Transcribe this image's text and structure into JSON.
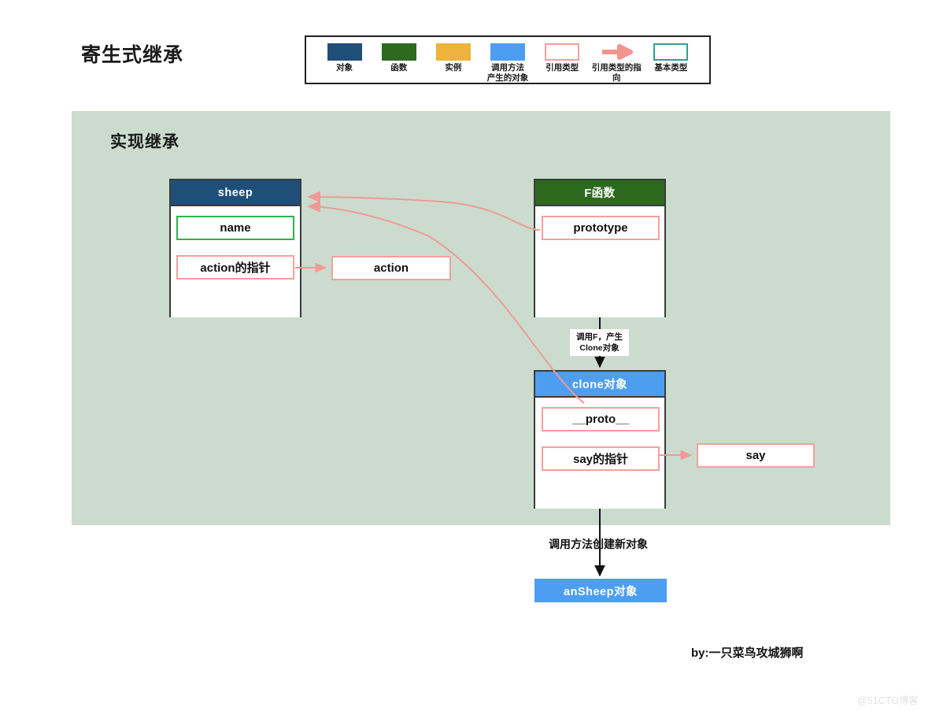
{
  "page": {
    "title": "寄生式继承",
    "credit": "by:一只菜鸟攻城狮啊",
    "watermark": "@51CTO博客",
    "background": "#ffffff"
  },
  "legend": {
    "items": [
      {
        "label": "对象",
        "swatch": "solid",
        "color": "#1f4e79",
        "icon": "filled-square-navy"
      },
      {
        "label": "函数",
        "swatch": "solid",
        "color": "#2d6a1f",
        "icon": "filled-square-green"
      },
      {
        "label": "实例",
        "swatch": "solid",
        "color": "#edb33c",
        "icon": "filled-square-yellow"
      },
      {
        "label": "调用方法\n产生的对象",
        "swatch": "solid",
        "color": "#4d9ef0",
        "icon": "filled-square-blue"
      },
      {
        "label": "引用类型",
        "swatch": "outline",
        "color": "#f4a09c",
        "icon": "outline-square-pink"
      },
      {
        "label": "引用类型的指向",
        "swatch": "arrow",
        "color": "#f4928c",
        "icon": "arrow-right-icon"
      },
      {
        "label": "基本类型",
        "swatch": "outline-teal",
        "color": "#2e9e96",
        "icon": "outline-square-teal"
      }
    ]
  },
  "panel": {
    "heading": "实现继承",
    "background": "#cbdccf"
  },
  "diagram": {
    "sheep": {
      "header": "sheep",
      "header_color": "#1f4e79",
      "fields": [
        {
          "label": "name",
          "kind": "primitive"
        },
        {
          "label": "action的指针",
          "kind": "reference"
        }
      ]
    },
    "action_box": {
      "label": "action"
    },
    "f_function": {
      "header": "F函数",
      "header_color": "#2d6a1f",
      "fields": [
        {
          "label": "prototype",
          "kind": "reference"
        }
      ]
    },
    "clone": {
      "header": "clone对象",
      "header_color": "#4d9ef0",
      "fields": [
        {
          "label": "__proto__",
          "kind": "reference"
        },
        {
          "label": "say的指针",
          "kind": "reference"
        }
      ]
    },
    "say_box": {
      "label": "say"
    },
    "ansheep": {
      "label": "anSheep对象",
      "color": "#4d9ef0"
    },
    "annotations": {
      "call_f": "调用F，产生\nClone对象",
      "create_new": "调用方法创建新对象"
    }
  }
}
